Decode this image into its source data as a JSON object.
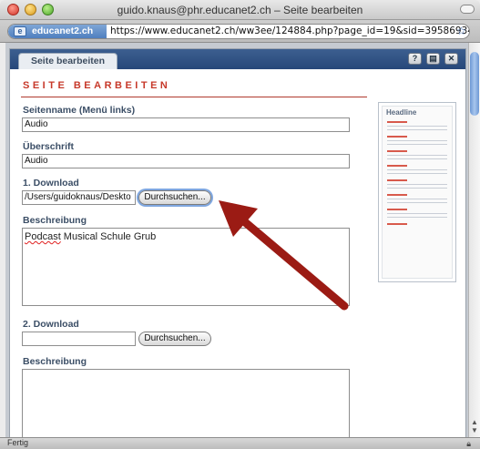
{
  "window": {
    "title": "guido.knaus@phr.educanet2.ch – Seite bearbeiten"
  },
  "address_bar": {
    "site_name": "educanet2.ch",
    "url": "https://www.educanet2.ch/ww3ee/124884.php?page_id=19&sid=3958693436"
  },
  "panel": {
    "tab_label": "Seite bearbeiten",
    "header_buttons": [
      {
        "name": "help-icon",
        "glyph": "?"
      },
      {
        "name": "print-icon",
        "glyph": "▤"
      },
      {
        "name": "close-icon",
        "glyph": "✕"
      }
    ],
    "section_title": "SEITE BEARBEITEN"
  },
  "form": {
    "page_name_label": "Seitenname (Menü links)",
    "page_name_value": "Audio",
    "heading_label": "Überschrift",
    "heading_value": "Audio",
    "download1_label": "1. Download",
    "download1_value": "/Users/guidoknaus/Deskto",
    "browse1_label": "Durchsuchen...",
    "description1_label": "Beschreibung",
    "description1_value_word1": "Podcast",
    "description1_value_rest": " Musical Schule Grub",
    "download2_label": "2. Download",
    "download2_value": "",
    "browse2_label": "Durchsuchen...",
    "description2_label": "Beschreibung",
    "description2_value": ""
  },
  "preview": {
    "headline": "Headline"
  },
  "status_bar": {
    "text": "Fertig"
  },
  "colors": {
    "accent_red": "#c7392a",
    "panel_header_blue": "#27477a",
    "annotation_arrow": "#9b1b14"
  }
}
